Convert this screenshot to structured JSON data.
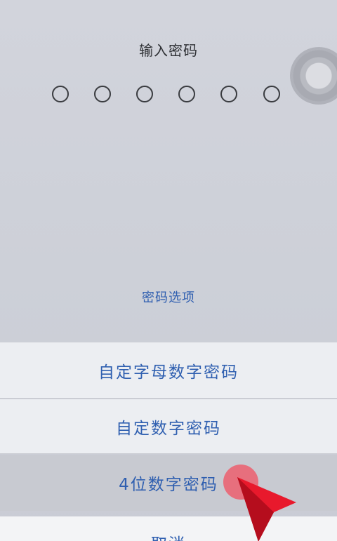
{
  "passcode_screen": {
    "title": "输入密码",
    "digit_slots": 6,
    "options_link": "密码选项"
  },
  "action_sheet": {
    "items": [
      {
        "label": "自定字母数字密码"
      },
      {
        "label": "自定数字密码"
      },
      {
        "label": "4位数字密码",
        "highlighted": true
      },
      {
        "label": "取消"
      }
    ]
  },
  "colors": {
    "link_blue": "#2f5fb0",
    "annotation_red": "#e8192c"
  }
}
